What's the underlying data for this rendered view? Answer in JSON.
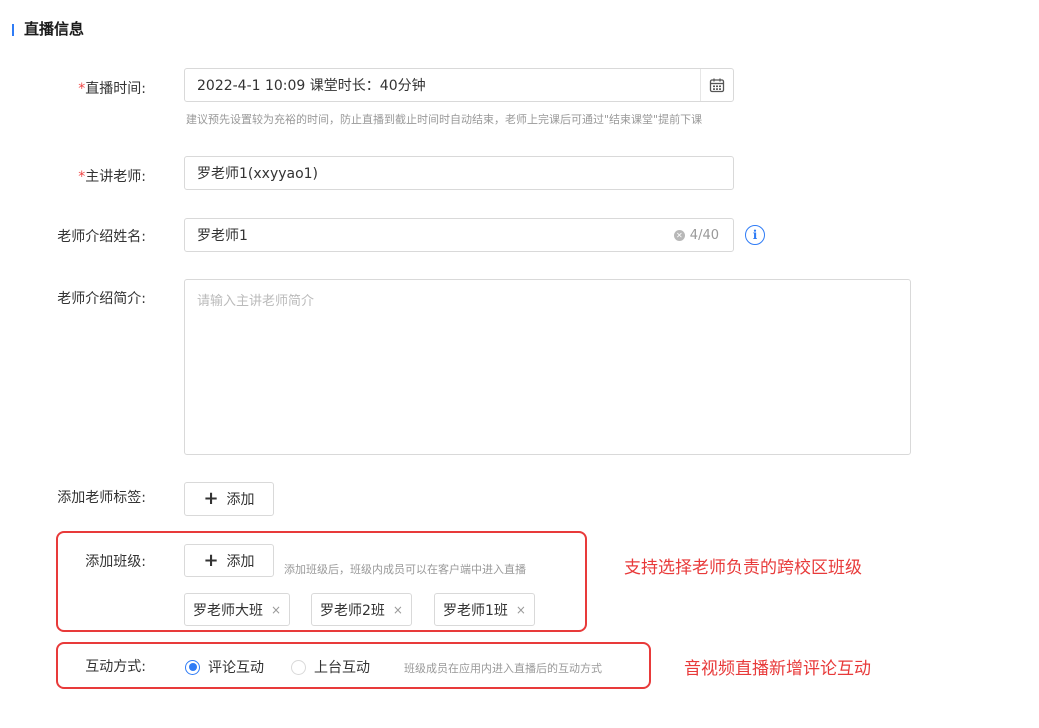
{
  "section": {
    "title": "直播信息"
  },
  "live_time": {
    "required_mark": "*",
    "label": "直播时间:",
    "value": "2022-4-1 10:09 课堂时长：40分钟",
    "hint": "建议预先设置较为充裕的时间，防止直播到截止时间时自动结束，老师上完课后可通过\"结束课堂\"提前下课"
  },
  "teacher": {
    "required_mark": "*",
    "label": "主讲老师:",
    "value": "罗老师1(xxyyao1)"
  },
  "intro_name": {
    "label": "老师介绍姓名:",
    "value": "罗老师1",
    "counter": "4/40"
  },
  "intro_desc": {
    "label": "老师介绍简介:",
    "placeholder": "请输入主讲老师简介"
  },
  "teacher_tags": {
    "label": "添加老师标签:",
    "add_label": "添加"
  },
  "classes": {
    "label": "添加班级:",
    "add_label": "添加",
    "hint": "添加班级后，班级内成员可以在客户端中进入直播",
    "tags": [
      "罗老师大班",
      "罗老师2班",
      "罗老师1班"
    ],
    "close_symbol": "×",
    "annotation": "支持选择老师负责的跨校区班级"
  },
  "interaction": {
    "label": "互动方式:",
    "options": [
      {
        "label": "评论互动",
        "selected": true
      },
      {
        "label": "上台互动",
        "selected": false
      }
    ],
    "hint": "班级成员在应用内进入直播后的互动方式",
    "annotation": "音视频直播新增评论互动"
  },
  "colors": {
    "accent": "#2f7cf6",
    "annotation_red": "#e83a3a",
    "required_red": "#f04646"
  },
  "icons": {
    "calendar": "calendar-icon",
    "clear": "clear-icon",
    "info": "info-icon",
    "plus": "plus-icon"
  }
}
